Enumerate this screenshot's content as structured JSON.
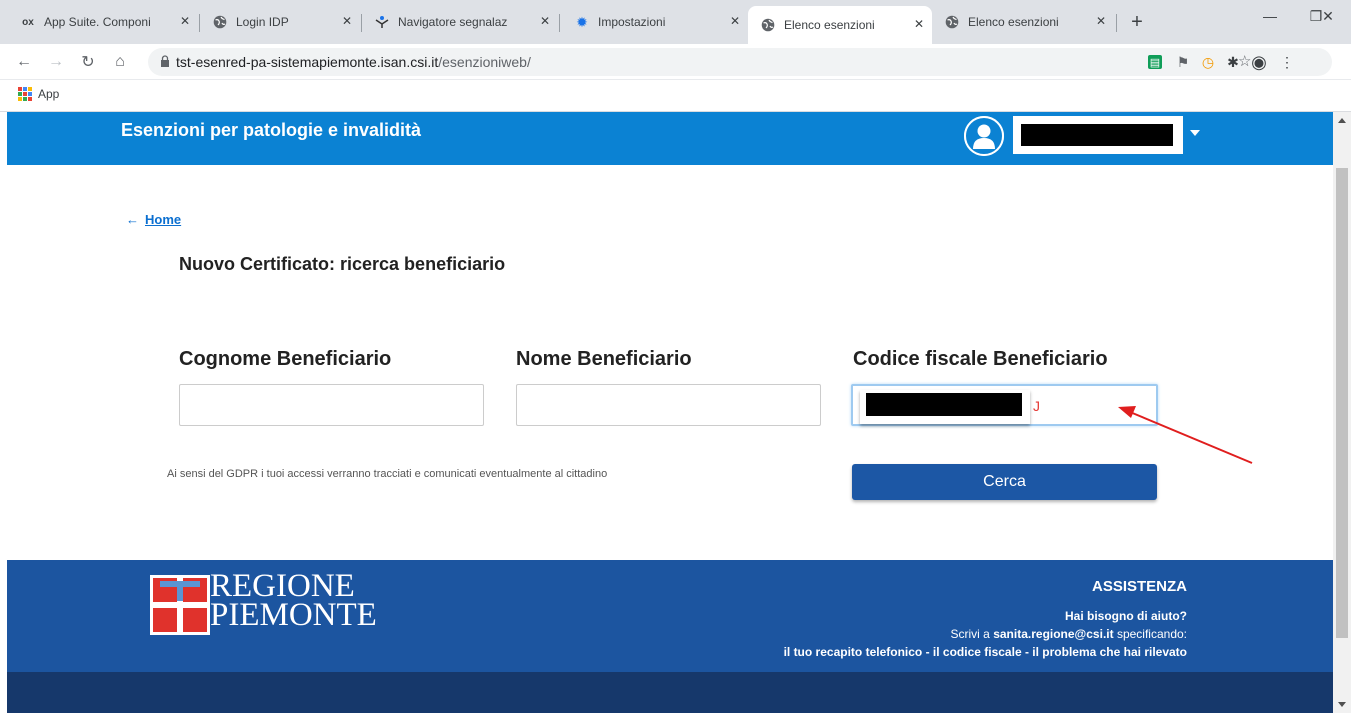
{
  "browser": {
    "tabs": [
      {
        "label": "App Suite. Componi",
        "icon": "ox-logo-icon",
        "active": false
      },
      {
        "label": "Login IDP",
        "icon": "globe-icon",
        "active": false
      },
      {
        "label": "Navigatore segnalaz",
        "icon": "navigator-icon",
        "active": false
      },
      {
        "label": "Impostazioni",
        "icon": "gear-icon",
        "active": false
      },
      {
        "label": "Elenco esenzioni",
        "icon": "globe-icon",
        "active": true
      },
      {
        "label": "Elenco esenzioni",
        "icon": "globe-icon",
        "active": false
      }
    ],
    "tab_logo_text": "ox",
    "new_tab_label": "+",
    "url_host": "tst-esenred-pa-sistemapiemonte.isan.csi.it",
    "url_path": "/esenzioniweb/",
    "bookmarks": [
      {
        "label": "App",
        "icon": "apps-grid-icon"
      }
    ]
  },
  "header": {
    "title": "Esenzioni per patologie e invalidità",
    "user_name_redacted": true
  },
  "main": {
    "back_arrow": "←",
    "back_link": "Home",
    "page_title": "Nuovo Certificato: ricerca beneficiario",
    "fields": [
      {
        "label": "Cognome Beneficiario",
        "value": ""
      },
      {
        "label": "Nome Beneficiario",
        "value": ""
      },
      {
        "label": "Codice fiscale Beneficiario",
        "value_tail": "J",
        "focused": true
      }
    ],
    "gdpr_note": "Ai sensi del GDPR i tuoi accessi verranno tracciati e comunicati eventualmente al cittadino",
    "search_button": "Cerca"
  },
  "footer": {
    "logo_line1": "REGIONE",
    "logo_line2": "PIEMONTE",
    "assist_title": "ASSISTENZA",
    "assist_question": "Hai bisogno di aiuto?",
    "assist_write_prefix": "Scrivi a",
    "assist_email": "sanita.regione@csi.it",
    "assist_write_suffix": "specificando:",
    "assist_details": "il tuo recapito telefonico - il codice fiscale - il problema che hai rilevato"
  },
  "colors": {
    "header_blue": "#0b82d3",
    "footer_blue": "#1c55a0",
    "footer_dark": "#16386b",
    "button_blue": "#1c57a5",
    "annotation_arrow": "#e01e1e",
    "logo_red": "#e0322c",
    "logo_blue": "#5b95d3"
  }
}
